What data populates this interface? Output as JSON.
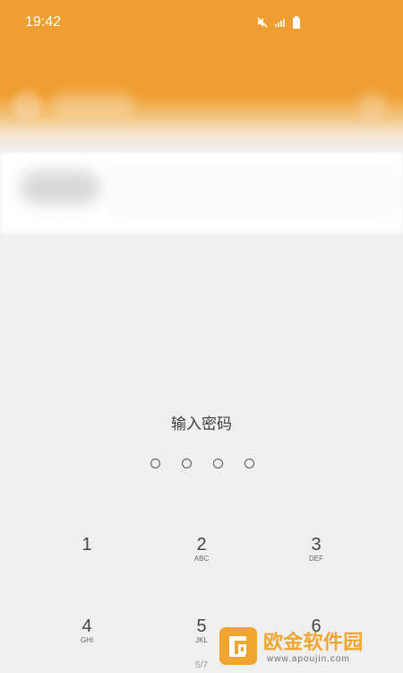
{
  "status_bar": {
    "time": "19:42"
  },
  "lock_screen": {
    "prompt": "输入密码",
    "pin_dots": [
      {
        "filled": false
      },
      {
        "filled": false
      },
      {
        "filled": false
      },
      {
        "filled": false
      }
    ],
    "keypad": [
      {
        "number": "1",
        "letters": ""
      },
      {
        "number": "2",
        "letters": "ABC"
      },
      {
        "number": "3",
        "letters": "DEF"
      },
      {
        "number": "4",
        "letters": "GHI"
      },
      {
        "number": "5",
        "letters": "JKL"
      },
      {
        "number": "6",
        "letters": ""
      }
    ],
    "page_indicator": "5/7"
  },
  "watermark": {
    "site_name": "欧金软件园",
    "url": "www.apoujin.com"
  },
  "colors": {
    "header": "#ef9f31",
    "background": "#efefef",
    "text_primary": "#444444",
    "watermark_accent": "#f1a531"
  },
  "icons": {
    "mute": "mute-icon",
    "signal": "signal-icon",
    "battery": "battery-icon",
    "logo": "watermark-logo-icon"
  }
}
